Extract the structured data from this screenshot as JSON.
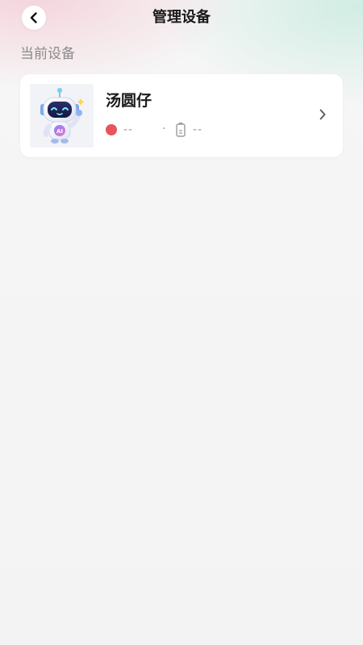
{
  "header": {
    "title": "管理设备",
    "back_icon": "chevron-left-icon"
  },
  "current_section": {
    "label": "当前设备"
  },
  "device": {
    "name": "汤圆仔",
    "avatar_icon": "robot-ai-icon",
    "avatar_text": "AI",
    "status_color": "#e8545a",
    "status_text": "--",
    "separator": "·",
    "battery_icon": "battery-icon",
    "battery_text": "--",
    "chevron_icon": "chevron-right-icon"
  }
}
